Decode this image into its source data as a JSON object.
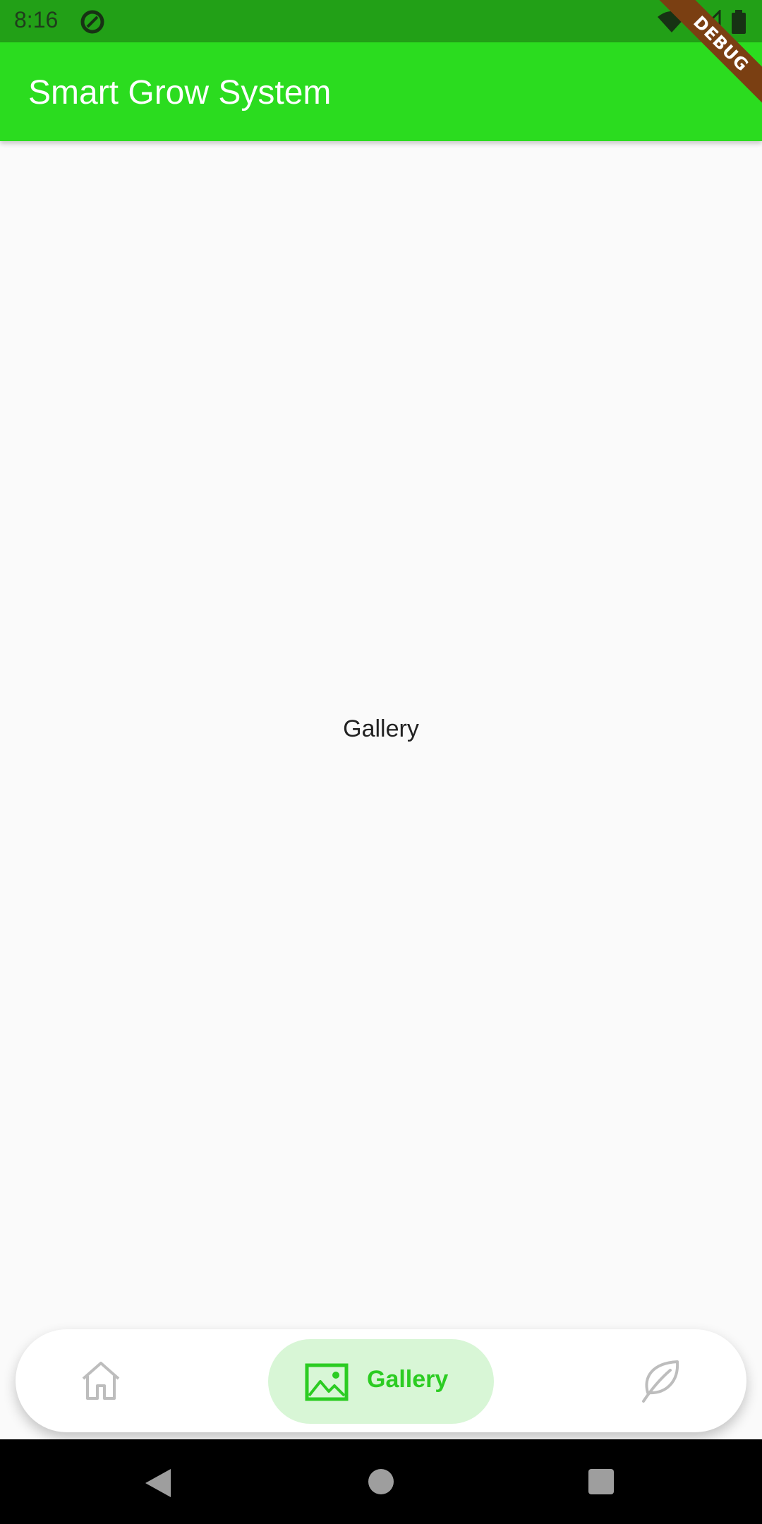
{
  "status_bar": {
    "time": "8:16",
    "icons": [
      "app-notification-icon",
      "wifi-icon",
      "signal-icon",
      "battery-icon"
    ]
  },
  "app_bar": {
    "title": "Smart Grow System",
    "color": "#2bdc1f"
  },
  "debug_banner": {
    "label": "DEBUG"
  },
  "content": {
    "label": "Gallery"
  },
  "bottom_nav": {
    "items": [
      {
        "id": "home",
        "icon": "home-icon",
        "label": "",
        "selected": false
      },
      {
        "id": "gallery",
        "icon": "image-icon",
        "label": "Gallery",
        "selected": true
      },
      {
        "id": "plants",
        "icon": "leaf-icon",
        "label": "",
        "selected": false
      }
    ],
    "active_color": "#2bcc22",
    "active_bg": "#d8f6d6",
    "inactive_color": "#bdbdbd"
  },
  "system_nav": {
    "buttons": [
      "back",
      "home",
      "recents"
    ]
  }
}
